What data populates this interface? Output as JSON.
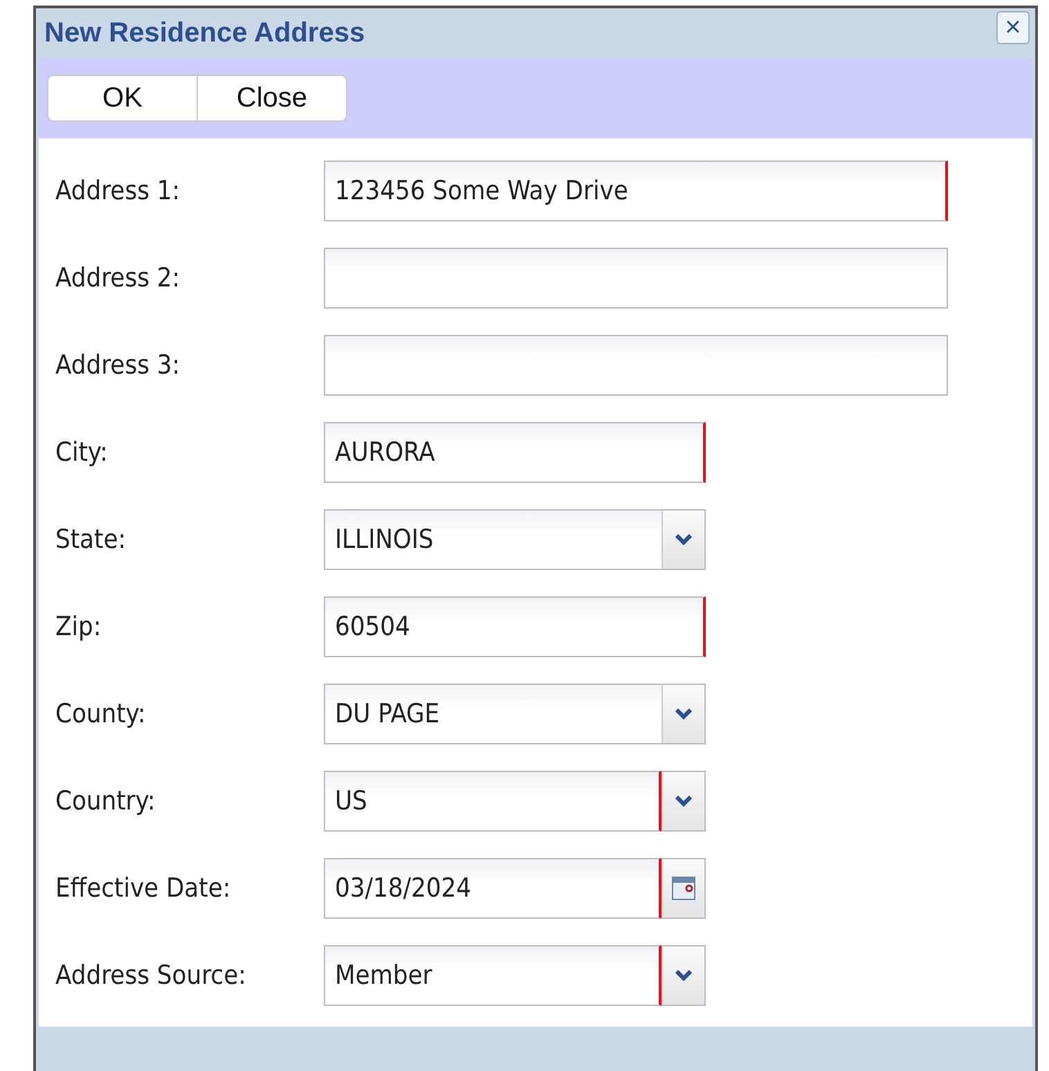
{
  "window": {
    "title": "New Residence Address",
    "close": "×"
  },
  "toolbar": {
    "buttons": [
      "OK",
      "Close"
    ]
  },
  "fields": [
    {
      "label": "Address 1:",
      "kind": "wide-text",
      "value": "123456 Some Way Drive",
      "required": true
    },
    {
      "label": "Address 2:",
      "kind": "wide-text",
      "required": false
    },
    {
      "label": "Address 3:",
      "kind": "wide-text",
      "required": false
    },
    {
      "label": "City:",
      "kind": "text",
      "value": "AURORA",
      "required": true
    },
    {
      "label": "State:",
      "kind": "select",
      "value": "ILLINOIS",
      "required": false
    },
    {
      "label": "Zip:",
      "kind": "text",
      "value": "60504",
      "required": true
    },
    {
      "label": "County:",
      "kind": "select",
      "value": "DU PAGE",
      "required": false
    },
    {
      "label": "Country:",
      "kind": "select",
      "value": "US",
      "required": true
    },
    {
      "label": "Effective Date:",
      "kind": "date",
      "value": "03/18/2024",
      "required": true
    },
    {
      "label": "Address Source:",
      "kind": "select",
      "value": "Member",
      "required": true
    }
  ]
}
